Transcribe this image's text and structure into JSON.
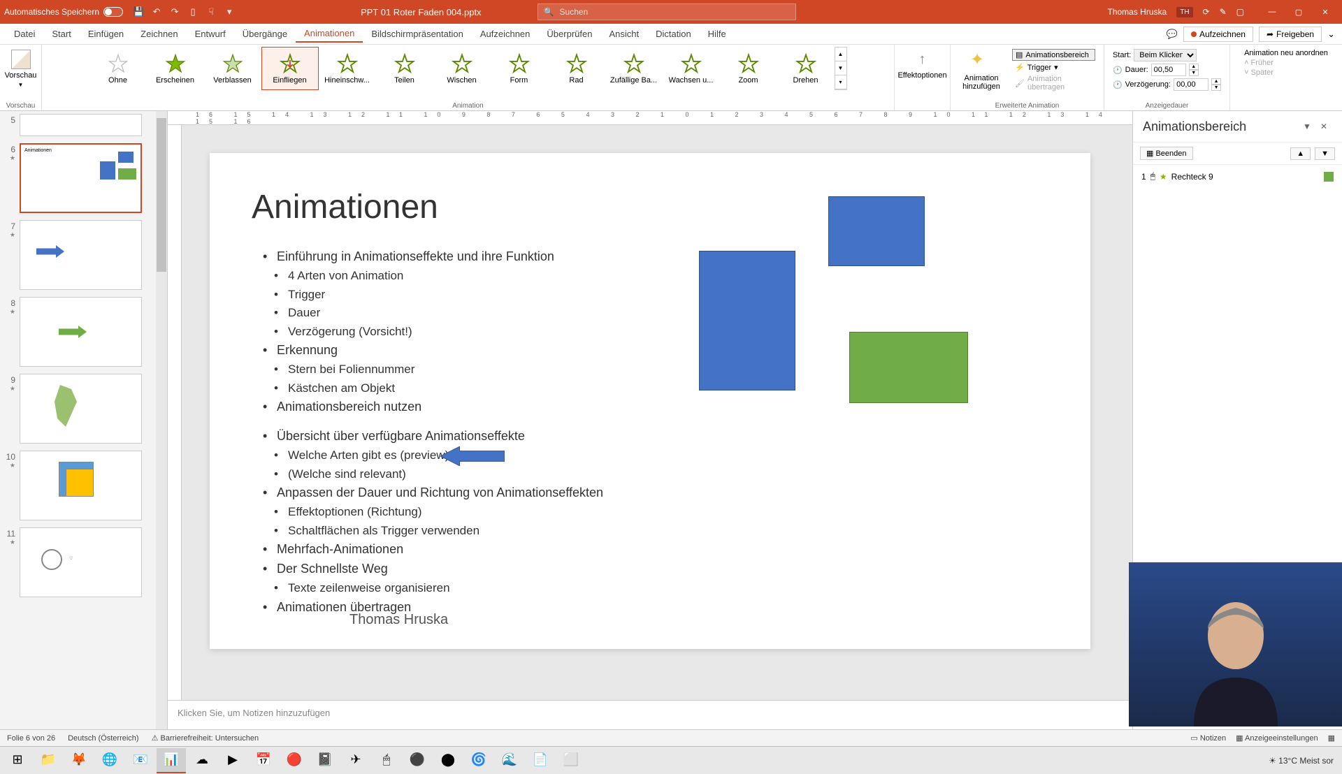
{
  "titlebar": {
    "autosave": "Automatisches Speichern",
    "filename": "PPT 01 Roter Faden 004.pptx",
    "search_placeholder": "Suchen",
    "user": "Thomas Hruska",
    "user_initials": "TH"
  },
  "tabs": {
    "datei": "Datei",
    "start": "Start",
    "einfuegen": "Einfügen",
    "zeichnen": "Zeichnen",
    "entwurf": "Entwurf",
    "uebergaenge": "Übergänge",
    "animationen": "Animationen",
    "bildschirm": "Bildschirmpräsentation",
    "aufzeichnen": "Aufzeichnen",
    "ueberpruefen": "Überprüfen",
    "ansicht": "Ansicht",
    "dictation": "Dictation",
    "hilfe": "Hilfe",
    "aufzeichnen_btn": "Aufzeichnen",
    "freigeben": "Freigeben"
  },
  "ribbon": {
    "vorschau": "Vorschau",
    "vorschau_group": "Vorschau",
    "animation_group": "Animation",
    "erweiterte_group": "Erweiterte Animation",
    "anzeigedauer_group": "Anzeigedauer",
    "anims": {
      "ohne": "Ohne",
      "erscheinen": "Erscheinen",
      "verblassen": "Verblassen",
      "einfliegen": "Einfliegen",
      "hineinschw": "Hineinschw...",
      "teilen": "Teilen",
      "wischen": "Wischen",
      "form": "Form",
      "rad": "Rad",
      "zufaellige": "Zufällige Ba...",
      "wachsen": "Wachsen u...",
      "zoom": "Zoom",
      "drehen": "Drehen"
    },
    "effektoptionen": "Effektoptionen",
    "animation_hinzu": "Animation hinzufügen",
    "animationsbereich": "Animationsbereich",
    "trigger": "Trigger",
    "uebertragen": "Animation übertragen",
    "start_label": "Start:",
    "start_value": "Beim Klicken",
    "dauer": "Dauer:",
    "dauer_value": "00,50",
    "verzoegerung": "Verzögerung:",
    "verzoegerung_value": "00,00",
    "neu_anordnen": "Animation neu anordnen",
    "frueher": "Früher",
    "spaeter": "Später"
  },
  "thumbs": [
    {
      "num": "5"
    },
    {
      "num": "6"
    },
    {
      "num": "7"
    },
    {
      "num": "8"
    },
    {
      "num": "9"
    },
    {
      "num": "10"
    },
    {
      "num": "11"
    }
  ],
  "slide": {
    "title": "Animationen",
    "bullets": {
      "b1": "Einführung in Animationseffekte und ihre Funktion",
      "b1_1": "4 Arten von Animation",
      "b1_2": "Trigger",
      "b1_3": "Dauer",
      "b1_4": "Verzögerung (Vorsicht!)",
      "b2": "Erkennung",
      "b2_1": "Stern bei Foliennummer",
      "b2_2": "Kästchen am Objekt",
      "b3": "Animationsbereich nutzen",
      "b4": "Übersicht über verfügbare Animationseffekte",
      "b4_1": "Welche Arten gibt es (preview)",
      "b4_2": "(Welche sind relevant)",
      "b5": "Anpassen der Dauer und Richtung von Animationseffekten",
      "b5_1": "Effektoptionen (Richtung)",
      "b5_2": "Schaltflächen als Trigger verwenden",
      "b6": "Mehrfach-Animationen",
      "b7": "Der Schnellste Weg",
      "b7_1": "Texte zeilenweise organisieren",
      "b8": "Animationen übertragen"
    },
    "presenter": "Thomas Hruska"
  },
  "notes": "Klicken Sie, um Notizen hinzuzufügen",
  "anim_pane": {
    "title": "Animationsbereich",
    "beenden": "Beenden",
    "item_num": "1",
    "item_name": "Rechteck 9"
  },
  "statusbar": {
    "folie": "Folie 6 von 26",
    "sprache": "Deutsch (Österreich)",
    "barriere": "Barrierefreiheit: Untersuchen",
    "notizen": "Notizen",
    "anzeige": "Anzeigeeinstellungen"
  },
  "taskbar": {
    "weather": "13°C  Meist sor"
  },
  "chart_data": null
}
